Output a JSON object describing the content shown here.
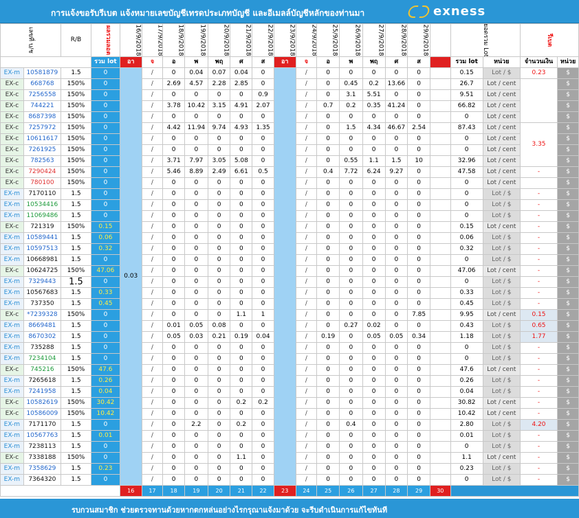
{
  "header": {
    "title": "การแจ้งขอรับรีเบต  แจ้งหมายเลขบัญชีเทรดประเภทบัญชี  และอีเมลล์บัญชีหลักของท่านมา",
    "brand": "exness"
  },
  "columns": {
    "account_no": "เลขที่ บ/ช",
    "rb": "R/B",
    "lot_sum_v": "ผลรวมลอต",
    "dates": [
      "16/9/2018",
      "17/9/2018",
      "18/9/2018",
      "19/9/2018",
      "20/9/2018",
      "21/9/2018",
      "22/9/2018",
      "23/9/2018",
      "24/9/2018",
      "25/9/2018",
      "26/9/2018",
      "27/9/2018",
      "28/9/2018",
      "29/9/2018"
    ],
    "total_lot": "ยอดรวม Lot",
    "rebate": "รีเบต",
    "sum_lot": "รวม lot",
    "day_sun": "อา",
    "days": [
      "จ",
      "อ",
      "พ",
      "พฤ",
      "ศ",
      "ส"
    ],
    "unit": "หน่วย",
    "amount": "จำนวนเงิน"
  },
  "blank_cell": "",
  "week1_side": "0.03",
  "rows": [
    {
      "type": "EX-m",
      "acc": "10581879",
      "acc_color": "blue",
      "rb": "1.5",
      "lot": "0",
      "d1": [
        "/",
        "0",
        "0.04",
        "0.07",
        "0.04",
        "0"
      ],
      "d2": [
        "/",
        "0",
        "0",
        "0",
        "0",
        "0"
      ],
      "total": "0.15",
      "unit": "Lot / $",
      "amount": "0.23"
    },
    {
      "type": "EX-c",
      "acc": "668768",
      "acc_color": "blue",
      "rb": "150%",
      "lot": "0",
      "d1": [
        "/",
        "2.69",
        "4.57",
        "2.28",
        "2.85",
        "0"
      ],
      "d2": [
        "/",
        "0",
        "0.45",
        "0.2",
        "13.66",
        "0"
      ],
      "total": "26.7",
      "unit": "Lot / cent",
      "amount": ""
    },
    {
      "type": "EX-c",
      "acc": "7256558",
      "acc_color": "blue",
      "rb": "150%",
      "lot": "0",
      "d1": [
        "/",
        "0",
        "0",
        "0",
        "0",
        "0.9"
      ],
      "d2": [
        "/",
        "0",
        "3.1",
        "5.51",
        "0",
        "0"
      ],
      "total": "9.51",
      "unit": "Lot / cent",
      "amount": ""
    },
    {
      "type": "EX-c",
      "acc": "744221",
      "acc_color": "blue",
      "rb": "150%",
      "lot": "0",
      "d1": [
        "/",
        "3.78",
        "10.42",
        "3.15",
        "4.91",
        "2.07"
      ],
      "d2": [
        "/",
        "0.7",
        "0.2",
        "0.35",
        "41.24",
        "0"
      ],
      "total": "66.82",
      "unit": "Lot / cent",
      "amount": ""
    },
    {
      "type": "EX-c",
      "acc": "8687398",
      "acc_color": "blue",
      "rb": "150%",
      "lot": "0",
      "d1": [
        "/",
        "0",
        "0",
        "0",
        "0",
        "0"
      ],
      "d2": [
        "/",
        "0",
        "0",
        "0",
        "0",
        "0"
      ],
      "total": "0",
      "unit": "Lot / cent",
      "amount": ""
    },
    {
      "type": "EX-c",
      "acc": "7257972",
      "acc_color": "blue",
      "rb": "150%",
      "lot": "0",
      "d1": [
        "/",
        "4.42",
        "11.94",
        "9.74",
        "4.93",
        "1.35"
      ],
      "d2": [
        "/",
        "0",
        "1.5",
        "4.34",
        "46.67",
        "2.54"
      ],
      "total": "87.43",
      "unit": "Lot / cent",
      "amount": "3.35"
    },
    {
      "type": "EX-c",
      "acc": "10611617",
      "acc_color": "blue",
      "rb": "150%",
      "lot": "0",
      "d1": [
        "/",
        "0",
        "0",
        "0",
        "0",
        "0"
      ],
      "d2": [
        "/",
        "0",
        "0",
        "0",
        "0",
        "0"
      ],
      "total": "0",
      "unit": "Lot / cent",
      "amount": ""
    },
    {
      "type": "EX-c",
      "acc": "7261925",
      "acc_color": "blue",
      "rb": "150%",
      "lot": "0",
      "d1": [
        "/",
        "0",
        "0",
        "0",
        "0",
        "0"
      ],
      "d2": [
        "/",
        "0",
        "0",
        "0",
        "0",
        "0"
      ],
      "total": "0",
      "unit": "Lot / cent",
      "amount": ""
    },
    {
      "type": "EX-c",
      "acc": "782563",
      "acc_color": "blue",
      "rb": "150%",
      "lot": "0",
      "d1": [
        "/",
        "3.71",
        "7.97",
        "3.05",
        "5.08",
        "0"
      ],
      "d2": [
        "/",
        "0",
        "0.55",
        "1.1",
        "1.5",
        "10"
      ],
      "total": "32.96",
      "unit": "Lot / cent",
      "amount": ""
    },
    {
      "type": "EX-c",
      "acc": "7290424",
      "acc_color": "red",
      "rb": "150%",
      "lot": "0",
      "d1": [
        "/",
        "5.46",
        "8.89",
        "2.49",
        "6.61",
        "0.5"
      ],
      "d2": [
        "/",
        "0.4",
        "7.72",
        "6.24",
        "9.27",
        "0"
      ],
      "total": "47.58",
      "unit": "Lot / cent",
      "amount": "-"
    },
    {
      "type": "EX-c",
      "acc": "780100",
      "acc_color": "red",
      "rb": "150%",
      "lot": "0",
      "d1": [
        "/",
        "0",
        "0",
        "0",
        "0",
        "0"
      ],
      "d2": [
        "/",
        "0",
        "0",
        "0",
        "0",
        "0"
      ],
      "total": "0",
      "unit": "Lot / cent",
      "amount": ""
    },
    {
      "type": "EX-m",
      "acc": "7170110",
      "acc_color": "blk",
      "rb": "1.5",
      "lot": "0",
      "d1": [
        "/",
        "0",
        "0",
        "0",
        "0",
        "0"
      ],
      "d2": [
        "/",
        "0",
        "0",
        "0",
        "0",
        "0"
      ],
      "total": "0",
      "unit": "Lot / $",
      "amount": "-"
    },
    {
      "type": "EX-m",
      "acc": "10534416",
      "acc_color": "green",
      "rb": "1.5",
      "lot": "0",
      "d1": [
        "/",
        "0",
        "0",
        "0",
        "0",
        "0"
      ],
      "d2": [
        "/",
        "0",
        "0",
        "0",
        "0",
        "0"
      ],
      "total": "0",
      "unit": "Lot / $",
      "amount": "-"
    },
    {
      "type": "EX-m",
      "acc": "11069486",
      "acc_color": "green",
      "rb": "1.5",
      "lot": "0",
      "d1": [
        "/",
        "0",
        "0",
        "0",
        "0",
        "0"
      ],
      "d2": [
        "/",
        "0",
        "0",
        "0",
        "0",
        "0"
      ],
      "total": "0",
      "unit": "Lot / $",
      "amount": "-"
    },
    {
      "type": "EX-c",
      "acc": "721319",
      "acc_color": "blk",
      "rb": "150%",
      "lot": "0.15",
      "lot_hl": true,
      "d1": [
        "/",
        "0",
        "0",
        "0",
        "0",
        "0"
      ],
      "d2": [
        "/",
        "0",
        "0",
        "0",
        "0",
        "0"
      ],
      "total": "0.15",
      "unit": "Lot / cent",
      "amount": "-"
    },
    {
      "type": "EX-m",
      "acc": "10589441",
      "acc_color": "blue",
      "rb": "1.5",
      "lot": "0.06",
      "lot_hl": true,
      "d1": [
        "/",
        "0",
        "0",
        "0",
        "0",
        "0"
      ],
      "d2": [
        "/",
        "0",
        "0",
        "0",
        "0",
        "0"
      ],
      "total": "0.06",
      "unit": "Lot / $",
      "amount": "-"
    },
    {
      "type": "EX-m",
      "acc": "10597513",
      "acc_color": "blue",
      "rb": "1.5",
      "lot": "0.32",
      "lot_hl": true,
      "d1": [
        "/",
        "0",
        "0",
        "0",
        "0",
        "0"
      ],
      "d2": [
        "/",
        "0",
        "0",
        "0",
        "0",
        "0"
      ],
      "total": "0.32",
      "unit": "Lot / $",
      "amount": "-"
    },
    {
      "type": "EX-m",
      "acc": "10668981",
      "acc_color": "blk",
      "rb": "1.5",
      "lot": "0",
      "d1": [
        "/",
        "0",
        "0",
        "0",
        "0",
        "0"
      ],
      "d2": [
        "/",
        "0",
        "0",
        "0",
        "0",
        "0"
      ],
      "total": "0",
      "unit": "Lot / $",
      "amount": "-"
    },
    {
      "type": "EX-c",
      "acc": "10624725",
      "acc_color": "blk",
      "rb": "150%",
      "lot": "47.06",
      "lot_hl": true,
      "d1": [
        "/",
        "0",
        "0",
        "0",
        "0",
        "0"
      ],
      "d2": [
        "/",
        "0",
        "0",
        "0",
        "0",
        "0"
      ],
      "total": "47.06",
      "unit": "Lot / cent",
      "amount": "-"
    },
    {
      "type": "EX-m",
      "acc": "7329443",
      "acc_color": "blue",
      "rb": "1.5",
      "rb_big": true,
      "lot": "0",
      "d1": [
        "/",
        "0",
        "0",
        "0",
        "0",
        "0"
      ],
      "d2": [
        "/",
        "0",
        "0",
        "0",
        "0",
        "0"
      ],
      "total": "0",
      "unit": "Lot / $",
      "amount": "-"
    },
    {
      "type": "EX-m",
      "acc": "10567683",
      "acc_color": "blk",
      "rb": "1.5",
      "lot": "0.33",
      "lot_hl": true,
      "d1": [
        "/",
        "0",
        "0",
        "0",
        "0",
        "0"
      ],
      "d2": [
        "/",
        "0",
        "0",
        "0",
        "0",
        "0"
      ],
      "total": "0.33",
      "unit": "Lot / $",
      "amount": "-"
    },
    {
      "type": "EX-m",
      "acc": "737350",
      "acc_color": "blk",
      "rb": "1.5",
      "lot": "0.45",
      "lot_hl": true,
      "d1": [
        "/",
        "0",
        "0",
        "0",
        "0",
        "0"
      ],
      "d2": [
        "/",
        "0",
        "0",
        "0",
        "0",
        "0"
      ],
      "total": "0.45",
      "unit": "Lot / $",
      "amount": "-"
    },
    {
      "type": "EX-c",
      "acc": "*7239328",
      "acc_color": "blue",
      "rb": "150%",
      "lot": "0",
      "d1": [
        "/",
        "0",
        "0",
        "0",
        "1.1",
        "1"
      ],
      "d2": [
        "/",
        "0",
        "0",
        "0",
        "0",
        "7.85"
      ],
      "total": "9.95",
      "unit": "Lot / cent",
      "amount": "0.15"
    },
    {
      "type": "EX-m",
      "acc": "8669481",
      "acc_color": "blue",
      "rb": "1.5",
      "lot": "0",
      "d1": [
        "/",
        "0.01",
        "0.05",
        "0.08",
        "0",
        "0"
      ],
      "d2": [
        "/",
        "0",
        "0.27",
        "0.02",
        "0",
        "0"
      ],
      "total": "0.43",
      "unit": "Lot / $",
      "amount": "0.65"
    },
    {
      "type": "EX-m",
      "acc": "8670302",
      "acc_color": "blue",
      "rb": "1.5",
      "lot": "0",
      "d1": [
        "/",
        "0.05",
        "0.03",
        "0.21",
        "0.19",
        "0.04"
      ],
      "d2": [
        "/",
        "0.19",
        "0",
        "0.05",
        "0.05",
        "0.34"
      ],
      "total": "1.18",
      "unit": "Lot / $",
      "amount": "1.77"
    },
    {
      "type": "EX-m",
      "acc": "735288",
      "acc_color": "blk",
      "rb": "1.5",
      "lot": "0",
      "d1": [
        "/",
        "0",
        "0",
        "0",
        "0",
        "0"
      ],
      "d2": [
        "/",
        "0",
        "0",
        "0",
        "0",
        "0"
      ],
      "total": "0",
      "unit": "Lot / $",
      "amount": "-"
    },
    {
      "type": "EX-m",
      "acc": "7234104",
      "acc_color": "green",
      "rb": "1.5",
      "lot": "0",
      "d1": [
        "/",
        "0",
        "0",
        "0",
        "0",
        "0"
      ],
      "d2": [
        "/",
        "0",
        "0",
        "0",
        "0",
        "0"
      ],
      "total": "0",
      "unit": "Lot / $",
      "amount": "-"
    },
    {
      "type": "EX-c",
      "acc": "745216",
      "acc_color": "green",
      "rb": "150%",
      "lot": "47.6",
      "lot_hl": true,
      "d1": [
        "/",
        "0",
        "0",
        "0",
        "0",
        "0"
      ],
      "d2": [
        "/",
        "0",
        "0",
        "0",
        "0",
        "0"
      ],
      "total": "47.6",
      "unit": "Lot / cent",
      "amount": "-"
    },
    {
      "type": "EX-m",
      "acc": "7265618",
      "acc_color": "blk",
      "rb": "1.5",
      "lot": "0.26",
      "lot_hl": true,
      "d1": [
        "/",
        "0",
        "0",
        "0",
        "0",
        "0"
      ],
      "d2": [
        "/",
        "0",
        "0",
        "0",
        "0",
        "0"
      ],
      "total": "0.26",
      "unit": "Lot / $",
      "amount": "-"
    },
    {
      "type": "EX-m",
      "acc": "7241958",
      "acc_color": "blue",
      "rb": "1.5",
      "lot": "0.04",
      "lot_hl": true,
      "d1": [
        "/",
        "0",
        "0",
        "0",
        "0",
        "0"
      ],
      "d2": [
        "/",
        "0",
        "0",
        "0",
        "0",
        "0"
      ],
      "total": "0.04",
      "unit": "Lot / $",
      "amount": "-"
    },
    {
      "type": "EX-c",
      "acc": "10582619",
      "acc_color": "blue",
      "rb": "150%",
      "lot": "30.42",
      "lot_hl": true,
      "d1": [
        "/",
        "0",
        "0",
        "0",
        "0.2",
        "0.2"
      ],
      "d2": [
        "/",
        "0",
        "0",
        "0",
        "0",
        "0"
      ],
      "total": "30.82",
      "unit": "Lot / cent",
      "amount": "-"
    },
    {
      "type": "EX-c",
      "acc": "10586009",
      "acc_color": "blue",
      "rb": "150%",
      "lot": "10.42",
      "lot_hl": true,
      "d1": [
        "/",
        "0",
        "0",
        "0",
        "0",
        "0"
      ],
      "d2": [
        "/",
        "0",
        "0",
        "0",
        "0",
        "0"
      ],
      "total": "10.42",
      "unit": "Lot / cent",
      "amount": "-"
    },
    {
      "type": "EX-m",
      "acc": "7171170",
      "acc_color": "blk",
      "rb": "1.5",
      "lot": "0",
      "d1": [
        "/",
        "0",
        "2.2",
        "0",
        "0.2",
        "0"
      ],
      "d2": [
        "/",
        "0",
        "0.4",
        "0",
        "0",
        "0"
      ],
      "total": "2.80",
      "unit": "Lot / $",
      "amount": "4.20"
    },
    {
      "type": "EX-m",
      "acc": "10567763",
      "acc_color": "blue",
      "rb": "1.5",
      "lot": "0.01",
      "lot_hl": true,
      "d1": [
        "/",
        "0",
        "0",
        "0",
        "0",
        "0"
      ],
      "d2": [
        "/",
        "0",
        "0",
        "0",
        "0",
        "0"
      ],
      "total": "0.01",
      "unit": "Lot / $",
      "amount": "-"
    },
    {
      "type": "EX-m",
      "acc": "7238113",
      "acc_color": "blk",
      "rb": "1.5",
      "lot": "0",
      "d1": [
        "/",
        "0",
        "0",
        "0",
        "0",
        "0"
      ],
      "d2": [
        "/",
        "0",
        "0",
        "0",
        "0",
        "0"
      ],
      "total": "0",
      "unit": "Lot / $",
      "amount": "-"
    },
    {
      "type": "EX-c",
      "acc": "7338188",
      "acc_color": "blk",
      "rb": "150%",
      "lot": "0",
      "d1": [
        "/",
        "0",
        "0",
        "0",
        "1.1",
        "0"
      ],
      "d2": [
        "/",
        "0",
        "0",
        "0",
        "0",
        "0"
      ],
      "total": "1.1",
      "unit": "Lot / cent",
      "amount": "-"
    },
    {
      "type": "EX-m",
      "acc": "7358629",
      "acc_color": "blue",
      "rb": "1.5",
      "lot": "0.23",
      "lot_hl": true,
      "d1": [
        "/",
        "0",
        "0",
        "0",
        "0",
        "0"
      ],
      "d2": [
        "/",
        "0",
        "0",
        "0",
        "0",
        "0"
      ],
      "total": "0.23",
      "unit": "Lot / $",
      "amount": "-"
    },
    {
      "type": "EX-m",
      "acc": "7364320",
      "acc_color": "blk",
      "rb": "1.5",
      "lot": "0",
      "d1": [
        "/",
        "0",
        "0",
        "0",
        "0",
        "0"
      ],
      "d2": [
        "/",
        "0",
        "0",
        "0",
        "0",
        "0"
      ],
      "total": "0",
      "unit": "Lot / $",
      "amount": "-"
    }
  ],
  "currency_symbol": "$",
  "footer_days": [
    "16",
    "17",
    "18",
    "19",
    "20",
    "21",
    "22",
    "23",
    "24",
    "25",
    "26",
    "27",
    "28",
    "29",
    "30"
  ],
  "footer": "รบกวนสมาชิก ช่วยตรวจทานด้วยหากตกหล่นอย่างไรกรุณาแจ้งมาด้วย  จะรีบดำเนินการแก้ไขทันที"
}
